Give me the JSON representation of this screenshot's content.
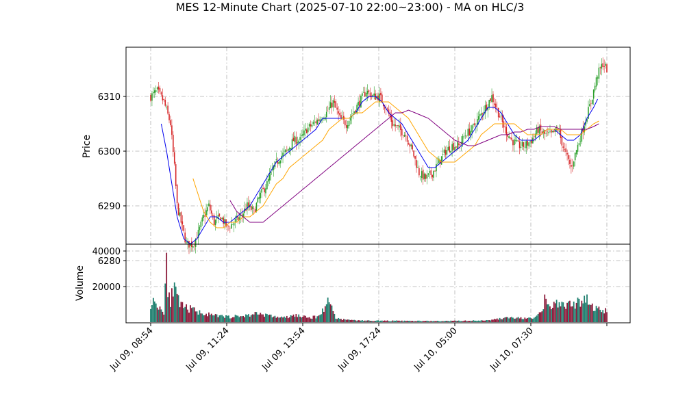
{
  "title": "MES 12-Minute Chart (2025-07-10 22:00~23:00) - MA on HLC/3",
  "colors": {
    "up": "#2ca02c",
    "down": "#d62728",
    "ma_fast": "#0000ee",
    "ma_mid": "#ffa500",
    "ma_slow": "#800080",
    "vol_up": "#1f7f6f",
    "vol_down": "#8b1a3a",
    "grid": "#b0b0b0"
  },
  "chart_data": [
    {
      "type": "candlestick",
      "ylabel": "Price",
      "ylim": [
        6283,
        6319
      ],
      "yticks": [
        6280,
        6290,
        6300,
        6310
      ],
      "xticks": [
        "Jul 09, 08:54",
        "Jul 09, 11:24",
        "Jul 09, 13:54",
        "Jul 09, 17:24",
        "Jul 10, 05:00",
        "Jul 10, 07:30"
      ],
      "grid": true,
      "close_path": [
        [
          0,
          6310
        ],
        [
          5,
          6311
        ],
        [
          10,
          6309
        ],
        [
          15,
          6305
        ],
        [
          18,
          6297
        ],
        [
          20,
          6290
        ],
        [
          23,
          6287
        ],
        [
          27,
          6283
        ],
        [
          32,
          6283
        ],
        [
          36,
          6285
        ],
        [
          40,
          6288
        ],
        [
          44,
          6290
        ],
        [
          48,
          6287
        ],
        [
          53,
          6288
        ],
        [
          58,
          6286
        ],
        [
          63,
          6287
        ],
        [
          68,
          6288
        ],
        [
          73,
          6290
        ],
        [
          78,
          6289
        ],
        [
          83,
          6292
        ],
        [
          88,
          6294
        ],
        [
          93,
          6297
        ],
        [
          98,
          6299
        ],
        [
          103,
          6300
        ],
        [
          108,
          6302
        ],
        [
          113,
          6302
        ],
        [
          118,
          6304
        ],
        [
          123,
          6305
        ],
        [
          128,
          6306
        ],
        [
          133,
          6307
        ],
        [
          138,
          6309
        ],
        [
          143,
          6306
        ],
        [
          148,
          6305
        ],
        [
          153,
          6307
        ],
        [
          158,
          6309
        ],
        [
          163,
          6311
        ],
        [
          168,
          6310
        ],
        [
          173,
          6310
        ],
        [
          178,
          6308
        ],
        [
          183,
          6305
        ],
        [
          188,
          6304
        ],
        [
          193,
          6303
        ],
        [
          198,
          6300
        ],
        [
          203,
          6296
        ],
        [
          208,
          6295
        ],
        [
          213,
          6296
        ],
        [
          218,
          6298
        ],
        [
          223,
          6300
        ],
        [
          228,
          6301
        ],
        [
          233,
          6301
        ],
        [
          238,
          6303
        ],
        [
          243,
          6304
        ],
        [
          248,
          6306
        ],
        [
          253,
          6308
        ],
        [
          258,
          6310
        ],
        [
          263,
          6307
        ],
        [
          268,
          6304
        ],
        [
          273,
          6302
        ],
        [
          278,
          6301
        ],
        [
          283,
          6301
        ],
        [
          288,
          6302
        ],
        [
          293,
          6304
        ],
        [
          298,
          6303
        ],
        [
          303,
          6303
        ],
        [
          308,
          6304
        ],
        [
          313,
          6300
        ],
        [
          318,
          6297
        ],
        [
          323,
          6301
        ],
        [
          328,
          6305
        ],
        [
          333,
          6309
        ],
        [
          338,
          6314
        ],
        [
          342,
          6316
        ],
        [
          345,
          6315
        ]
      ],
      "candle_count": 346,
      "ma_fast": [
        [
          8,
          6305
        ],
        [
          12,
          6300
        ],
        [
          16,
          6294
        ],
        [
          20,
          6288
        ],
        [
          25,
          6284
        ],
        [
          30,
          6283
        ],
        [
          35,
          6284
        ],
        [
          40,
          6286
        ],
        [
          45,
          6288
        ],
        [
          50,
          6288
        ],
        [
          55,
          6287
        ],
        [
          60,
          6287
        ],
        [
          65,
          6288
        ],
        [
          70,
          6289
        ],
        [
          75,
          6290
        ],
        [
          80,
          6292
        ],
        [
          85,
          6294
        ],
        [
          90,
          6296
        ],
        [
          95,
          6298
        ],
        [
          100,
          6299
        ],
        [
          105,
          6300
        ],
        [
          110,
          6301
        ],
        [
          115,
          6302
        ],
        [
          120,
          6303
        ],
        [
          125,
          6304
        ],
        [
          130,
          6306
        ],
        [
          135,
          6306
        ],
        [
          140,
          6306
        ],
        [
          145,
          6306
        ],
        [
          150,
          6306
        ],
        [
          155,
          6307
        ],
        [
          160,
          6309
        ],
        [
          165,
          6310
        ],
        [
          170,
          6310
        ],
        [
          175,
          6309
        ],
        [
          180,
          6307
        ],
        [
          185,
          6306
        ],
        [
          190,
          6305
        ],
        [
          195,
          6303
        ],
        [
          200,
          6301
        ],
        [
          205,
          6299
        ],
        [
          210,
          6297
        ],
        [
          215,
          6297
        ],
        [
          220,
          6298
        ],
        [
          225,
          6299
        ],
        [
          230,
          6300
        ],
        [
          235,
          6301
        ],
        [
          240,
          6302
        ],
        [
          245,
          6304
        ],
        [
          250,
          6306
        ],
        [
          255,
          6308
        ],
        [
          260,
          6308
        ],
        [
          265,
          6307
        ],
        [
          270,
          6305
        ],
        [
          275,
          6303
        ],
        [
          280,
          6302
        ],
        [
          285,
          6302
        ],
        [
          290,
          6302
        ],
        [
          295,
          6303
        ],
        [
          300,
          6304
        ],
        [
          305,
          6304
        ],
        [
          310,
          6303
        ],
        [
          315,
          6302
        ],
        [
          320,
          6302
        ],
        [
          325,
          6303
        ],
        [
          330,
          6306
        ],
        [
          335,
          6308
        ],
        [
          338,
          6309.5
        ]
      ],
      "ma_mid": [
        [
          32,
          6295
        ],
        [
          36,
          6292
        ],
        [
          40,
          6289
        ],
        [
          45,
          6287
        ],
        [
          50,
          6286
        ],
        [
          55,
          6286
        ],
        [
          60,
          6287
        ],
        [
          65,
          6287
        ],
        [
          70,
          6288
        ],
        [
          75,
          6288
        ],
        [
          80,
          6289
        ],
        [
          85,
          6290
        ],
        [
          90,
          6292
        ],
        [
          95,
          6294
        ],
        [
          100,
          6295
        ],
        [
          105,
          6297
        ],
        [
          110,
          6298
        ],
        [
          115,
          6299
        ],
        [
          120,
          6300
        ],
        [
          125,
          6301
        ],
        [
          130,
          6302
        ],
        [
          135,
          6304
        ],
        [
          140,
          6305
        ],
        [
          145,
          6306
        ],
        [
          150,
          6306
        ],
        [
          155,
          6307
        ],
        [
          160,
          6307
        ],
        [
          165,
          6308
        ],
        [
          170,
          6309
        ],
        [
          175,
          6309
        ],
        [
          180,
          6309
        ],
        [
          185,
          6308
        ],
        [
          190,
          6307
        ],
        [
          195,
          6306
        ],
        [
          200,
          6304
        ],
        [
          205,
          6302
        ],
        [
          210,
          6300
        ],
        [
          215,
          6299
        ],
        [
          220,
          6298
        ],
        [
          225,
          6298
        ],
        [
          230,
          6298
        ],
        [
          235,
          6299
        ],
        [
          240,
          6300
        ],
        [
          245,
          6301
        ],
        [
          250,
          6303
        ],
        [
          255,
          6304
        ],
        [
          260,
          6305
        ],
        [
          265,
          6305
        ],
        [
          270,
          6305
        ],
        [
          275,
          6305
        ],
        [
          280,
          6304
        ],
        [
          285,
          6303
        ],
        [
          290,
          6303
        ],
        [
          295,
          6303
        ],
        [
          300,
          6304
        ],
        [
          305,
          6304
        ],
        [
          310,
          6304
        ],
        [
          315,
          6303
        ],
        [
          320,
          6303
        ],
        [
          325,
          6303
        ],
        [
          330,
          6304
        ],
        [
          335,
          6305
        ],
        [
          339,
          6305.5
        ]
      ],
      "ma_slow": [
        [
          60,
          6291
        ],
        [
          65,
          6289
        ],
        [
          70,
          6288
        ],
        [
          75,
          6287
        ],
        [
          80,
          6287
        ],
        [
          85,
          6287
        ],
        [
          90,
          6288
        ],
        [
          95,
          6289
        ],
        [
          100,
          6290
        ],
        [
          105,
          6291
        ],
        [
          110,
          6292
        ],
        [
          115,
          6293
        ],
        [
          120,
          6294
        ],
        [
          125,
          6295
        ],
        [
          130,
          6296
        ],
        [
          135,
          6297
        ],
        [
          140,
          6298
        ],
        [
          145,
          6299
        ],
        [
          150,
          6300
        ],
        [
          155,
          6301
        ],
        [
          160,
          6302
        ],
        [
          165,
          6303
        ],
        [
          170,
          6304
        ],
        [
          175,
          6305
        ],
        [
          180,
          6306
        ],
        [
          185,
          6307
        ],
        [
          190,
          6307
        ],
        [
          195,
          6307.5
        ],
        [
          200,
          6307
        ],
        [
          205,
          6306.5
        ],
        [
          210,
          6306
        ],
        [
          215,
          6305
        ],
        [
          220,
          6304
        ],
        [
          225,
          6303
        ],
        [
          230,
          6302
        ],
        [
          235,
          6301.5
        ],
        [
          240,
          6301
        ],
        [
          245,
          6301
        ],
        [
          250,
          6301.5
        ],
        [
          255,
          6302
        ],
        [
          260,
          6302.5
        ],
        [
          265,
          6303
        ],
        [
          270,
          6303
        ],
        [
          275,
          6303.5
        ],
        [
          280,
          6303.5
        ],
        [
          285,
          6304
        ],
        [
          290,
          6304
        ],
        [
          295,
          6304.5
        ],
        [
          300,
          6304.5
        ],
        [
          305,
          6304.5
        ],
        [
          310,
          6304
        ],
        [
          315,
          6304
        ],
        [
          320,
          6304
        ],
        [
          325,
          6304
        ],
        [
          330,
          6304
        ],
        [
          335,
          6304.5
        ],
        [
          339,
          6305
        ]
      ]
    },
    {
      "type": "bar",
      "ylabel": "Volume",
      "ylim": [
        0,
        40000
      ],
      "yticks": [
        20000,
        40000
      ],
      "grid": true,
      "volume_profile": [
        [
          0,
          10500
        ],
        [
          3,
          11500
        ],
        [
          6,
          9000
        ],
        [
          9,
          7000
        ],
        [
          10,
          4000
        ],
        [
          11,
          22000
        ],
        [
          12,
          39000
        ],
        [
          13,
          20000
        ],
        [
          15,
          12000
        ],
        [
          17,
          19000
        ],
        [
          19,
          16000
        ],
        [
          21,
          12000
        ],
        [
          23,
          9000
        ],
        [
          26,
          8000
        ],
        [
          30,
          7500
        ],
        [
          35,
          6000
        ],
        [
          40,
          5000
        ],
        [
          45,
          4000
        ],
        [
          50,
          3500
        ],
        [
          60,
          3000
        ],
        [
          70,
          3500
        ],
        [
          75,
          4000
        ],
        [
          80,
          5000
        ],
        [
          85,
          4500
        ],
        [
          90,
          3500
        ],
        [
          95,
          3000
        ],
        [
          100,
          2500
        ],
        [
          105,
          3000
        ],
        [
          110,
          4000
        ],
        [
          115,
          3000
        ],
        [
          120,
          2500
        ],
        [
          125,
          3000
        ],
        [
          128,
          4000
        ],
        [
          130,
          6500
        ],
        [
          133,
          11000
        ],
        [
          136,
          11500
        ],
        [
          138,
          6000
        ],
        [
          140,
          2500
        ],
        [
          145,
          1500
        ],
        [
          160,
          900
        ],
        [
          190,
          700
        ],
        [
          220,
          600
        ],
        [
          250,
          900
        ],
        [
          260,
          1500
        ],
        [
          270,
          2500
        ],
        [
          280,
          2200
        ],
        [
          290,
          2000
        ],
        [
          292,
          3500
        ],
        [
          295,
          5000
        ],
        [
          298,
          12000
        ],
        [
          302,
          8000
        ],
        [
          306,
          11000
        ],
        [
          310,
          9000
        ],
        [
          315,
          10500
        ],
        [
          320,
          9000
        ],
        [
          325,
          12000
        ],
        [
          330,
          14000
        ],
        [
          335,
          8000
        ],
        [
          340,
          7000
        ],
        [
          345,
          6000
        ]
      ]
    }
  ]
}
